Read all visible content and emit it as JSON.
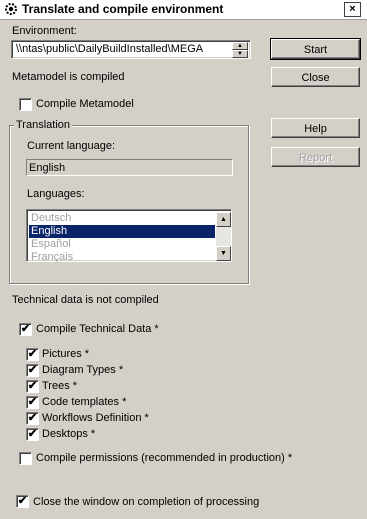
{
  "window": {
    "title": "Translate and compile environment",
    "close_glyph": "×"
  },
  "environment": {
    "label": "Environment:",
    "value": "\\\\ntas\\public\\DailyBuildInstalled\\MEGA"
  },
  "buttons": {
    "start": "Start",
    "close": "Close",
    "help": "Help",
    "report": "Report"
  },
  "metamodel": {
    "status": "Metamodel is compiled",
    "compile_label": "Compile Metamodel",
    "compile_checked": false
  },
  "translation": {
    "group_title": "Translation",
    "current_language_label": "Current language:",
    "current_language_value": "English",
    "languages_label": "Languages:",
    "languages": [
      {
        "label": "Deutsch",
        "selected": false
      },
      {
        "label": "English",
        "selected": true
      },
      {
        "label": "Español",
        "selected": false
      },
      {
        "label": "Français",
        "selected": false
      }
    ]
  },
  "technical": {
    "status": "Technical data is not compiled",
    "compile_label": "Compile Technical Data *",
    "compile_checked": true,
    "items": [
      {
        "label": "Pictures *",
        "checked": true
      },
      {
        "label": "Diagram Types *",
        "checked": true
      },
      {
        "label": "Trees *",
        "checked": true
      },
      {
        "label": "Code templates *",
        "checked": true
      },
      {
        "label": "Workflows Definition *",
        "checked": true
      },
      {
        "label": "Desktops *",
        "checked": true
      }
    ]
  },
  "permissions": {
    "label": "Compile permissions (recommended in production) *",
    "checked": false
  },
  "close_on_completion": {
    "label": "Close the window on completion of processing",
    "checked": true
  },
  "check_glyph": "✔",
  "colors": {
    "dialog_bg": "#d4d0c8",
    "selection": "#0a246a",
    "disabled_text": "#a0a0a0"
  }
}
